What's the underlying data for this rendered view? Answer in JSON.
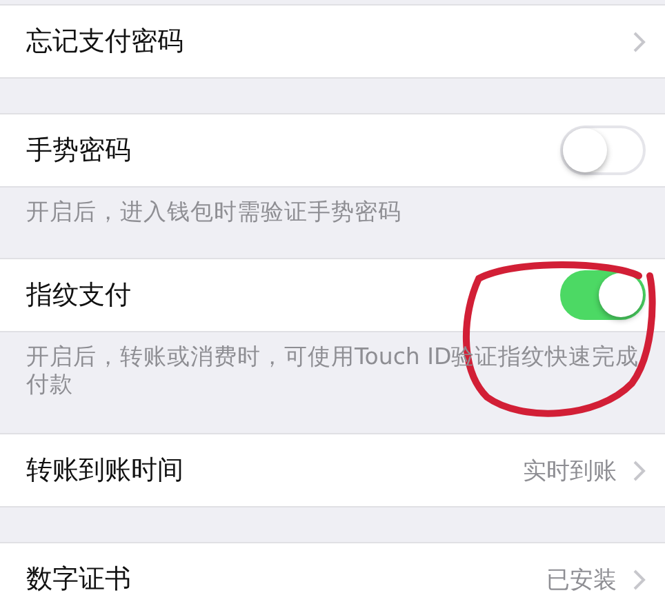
{
  "sections": [
    {
      "rows": [
        {
          "kind": "link",
          "label": "忘记支付密码"
        }
      ]
    },
    {
      "rows": [
        {
          "kind": "toggle",
          "label": "手势密码",
          "on": false
        }
      ],
      "footer": "开启后，进入钱包时需验证手势密码"
    },
    {
      "rows": [
        {
          "kind": "toggle",
          "label": "指纹支付",
          "on": true
        }
      ],
      "footer": "开启后，转账或消费时，可使用Touch ID验证指纹快速完成付款"
    },
    {
      "rows": [
        {
          "kind": "link",
          "label": "转账到账时间",
          "value": "实时到账"
        }
      ]
    },
    {
      "rows": [
        {
          "kind": "link",
          "label": "数字证书",
          "value": "已安装"
        }
      ]
    }
  ]
}
